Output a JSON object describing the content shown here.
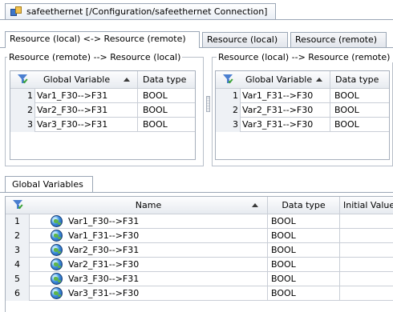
{
  "document_tab": {
    "title": "safeethernet [/Configuration/safeethernet Connection]"
  },
  "resource_tabs": [
    {
      "label": "Resource (local) <-> Resource (remote)"
    },
    {
      "label": "Resource (local)"
    },
    {
      "label": "Resource (remote)"
    }
  ],
  "left_group": {
    "title": "Resource (remote) --> Resource (local)",
    "columns": {
      "variable": "Global Variable",
      "type": "Data type"
    },
    "rows": [
      {
        "num": "1",
        "variable": "Var1_F30-->F31",
        "type": "BOOL"
      },
      {
        "num": "2",
        "variable": "Var2_F30-->F31",
        "type": "BOOL"
      },
      {
        "num": "3",
        "variable": "Var3_F30-->F31",
        "type": "BOOL"
      }
    ]
  },
  "right_group": {
    "title": "Resource (local) --> Resource (remote)",
    "columns": {
      "variable": "Global Variable",
      "type": "Data type"
    },
    "rows": [
      {
        "num": "1",
        "variable": "Var1_F31-->F30",
        "type": "BOOL"
      },
      {
        "num": "2",
        "variable": "Var2_F31-->F30",
        "type": "BOOL"
      },
      {
        "num": "3",
        "variable": "Var3_F31-->F30",
        "type": "BOOL"
      }
    ]
  },
  "global_variables": {
    "tab_label": "Global Variables",
    "columns": {
      "name": "Name",
      "type": "Data type",
      "initial": "Initial Value"
    },
    "rows": [
      {
        "num": "1",
        "name": "Var1_F30-->F31",
        "type": "BOOL"
      },
      {
        "num": "2",
        "name": "Var1_F31-->F30",
        "type": "BOOL"
      },
      {
        "num": "3",
        "name": "Var2_F30-->F31",
        "type": "BOOL"
      },
      {
        "num": "4",
        "name": "Var2_F31-->F30",
        "type": "BOOL"
      },
      {
        "num": "5",
        "name": "Var3_F30-->F31",
        "type": "BOOL"
      },
      {
        "num": "6",
        "name": "Var3_F31-->F30",
        "type": "BOOL"
      }
    ]
  },
  "icons": {
    "document": "network-connection-icon",
    "filter": "filter-funnel-icon",
    "sort": "sort-ascending-icon",
    "variable": "global-variable-globe-icon"
  }
}
